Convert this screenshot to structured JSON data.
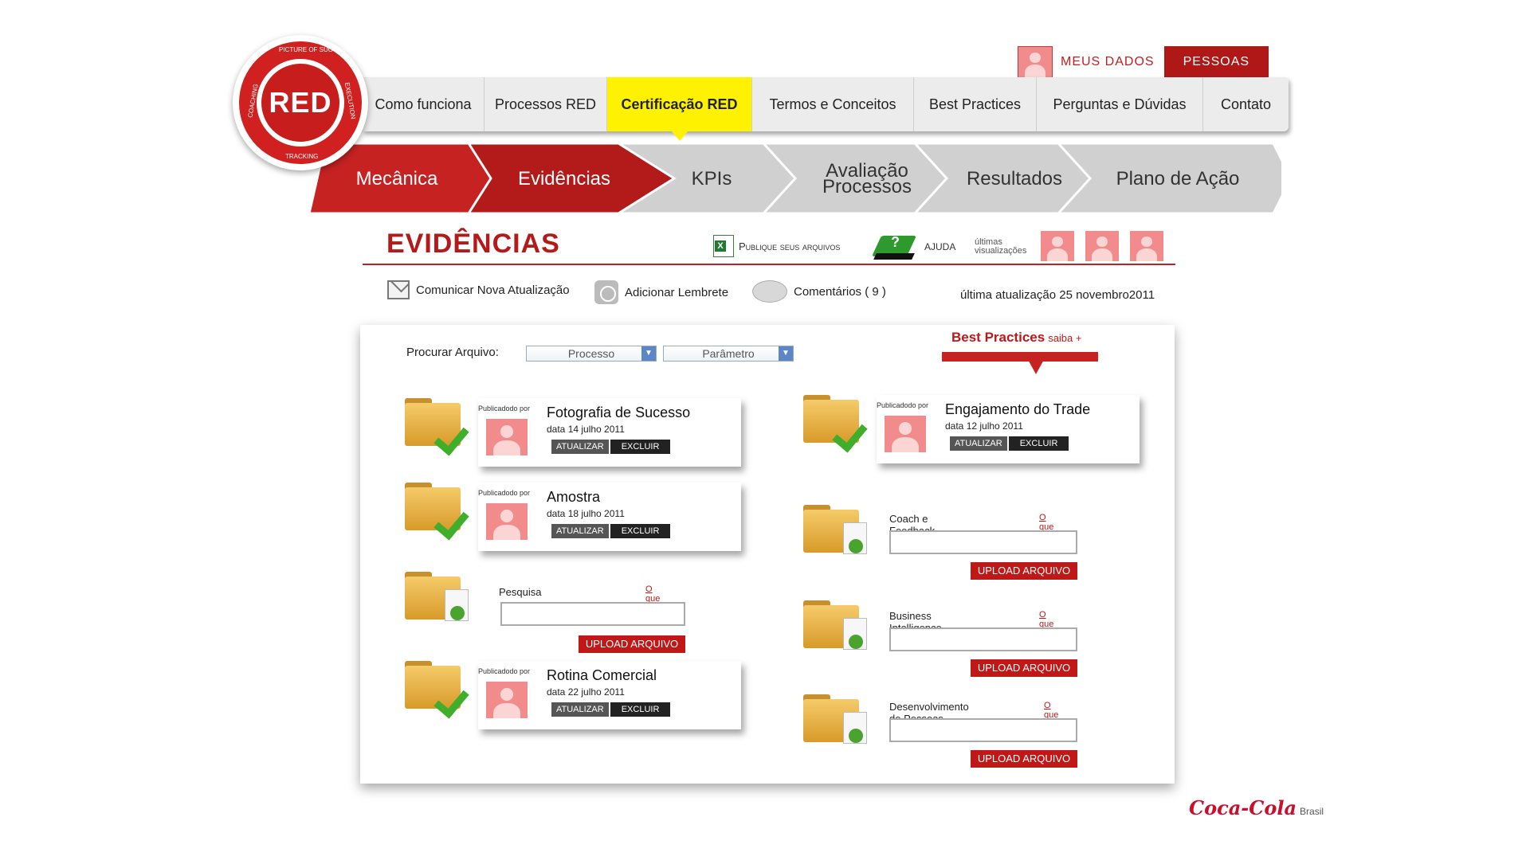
{
  "logo": {
    "text": "RED",
    "ring_top": "PICTURE OF SUCCESS",
    "ring_left": "COACHING",
    "ring_right": "EXECUTION",
    "ring_bottom": "TRACKING"
  },
  "user_links": {
    "meus_dados": "MEUS DADOS",
    "pessoas": "PESSOAS"
  },
  "nav": [
    {
      "label": "Como funciona",
      "active": false
    },
    {
      "label": "Processos RED",
      "active": false
    },
    {
      "label": "Certificação RED",
      "active": true
    },
    {
      "label": "Termos e Conceitos",
      "active": false
    },
    {
      "label": "Best Practices",
      "active": false
    },
    {
      "label": "Perguntas e Dúvidas",
      "active": false
    },
    {
      "label": "Contato",
      "active": false
    }
  ],
  "steps": [
    {
      "label": "Mecânica",
      "state": "red"
    },
    {
      "label": "Evidências",
      "state": "red"
    },
    {
      "label": "KPIs",
      "state": "grey"
    },
    {
      "label_line1": "Avaliação",
      "label_line2": "Processos",
      "state": "grey"
    },
    {
      "label": "Resultados",
      "state": "grey"
    },
    {
      "label": "Plano de Ação",
      "state": "grey"
    }
  ],
  "header": {
    "title": "EVIDÊNCIAS",
    "publique": "Publique seus arquivos",
    "ajuda": "AJUDA",
    "ultimas_line1": "últimas",
    "ultimas_line2": "visualizações"
  },
  "actions": {
    "comunicar": "Comunicar Nova  Atualização",
    "lembrete": "Adicionar Lembrete",
    "comentarios": "Comentários ( 9 )",
    "last_update": "última atualização 25 novembro2011"
  },
  "search": {
    "label": "Procurar Arquivo:",
    "processo": "Processo",
    "parametro": "Parâmetro"
  },
  "best_practices": {
    "title": "Best Practices",
    "more": "saiba +"
  },
  "labels": {
    "publicado_por": "Publicadodo por",
    "atualizar": "ATUALIZAR",
    "excluir": "EXCLUIR",
    "oque": "O que é?",
    "upload": "UPLOAD ARQUIVO"
  },
  "evidences": [
    {
      "name": "Fotografia de Sucesso",
      "date": "data 14 julho 2011"
    },
    {
      "name": "Amostra",
      "date": "data 18 julho 2011"
    },
    {
      "name": "Rotina Comercial",
      "date": "data 22 julho 2011"
    },
    {
      "name": "Engajamento do Trade",
      "date": "data 12 julho 2011"
    }
  ],
  "uploads": [
    {
      "label": "Pesquisa"
    },
    {
      "label": "Coach e Feedback"
    },
    {
      "label": "Business Intelligence"
    },
    {
      "label": "Desenvolvimento de Pessoas"
    }
  ],
  "footer": {
    "brand": "Coca-Cola",
    "country": "Brasil"
  },
  "colors": {
    "brand_red": "#c01717",
    "active_tab": "#fff200",
    "step_grey": "#d0d0d0"
  }
}
